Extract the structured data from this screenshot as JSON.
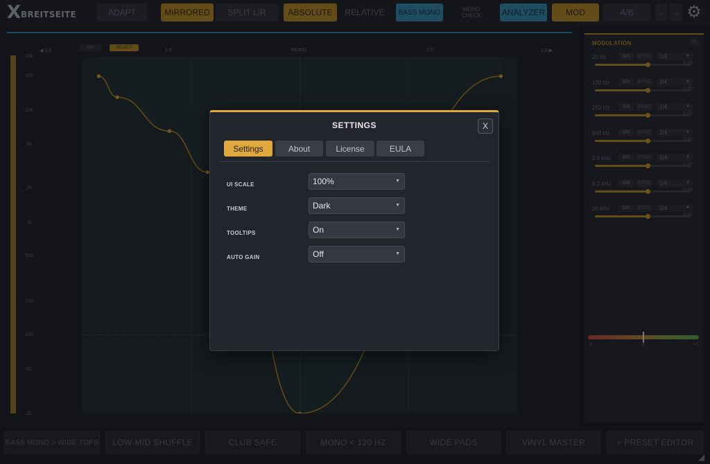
{
  "toolbar": {
    "logo_mark": "X",
    "logo_text": "BREITSEITE",
    "adapt": "ADAPT",
    "mirrored": "MIRRORED",
    "split": "SPLIT L/R",
    "absolute": "ABSOLUTE",
    "relative": "RELATIVE",
    "bass_mono": "BASS MONO",
    "mono_check_1": "MONO",
    "mono_check_2": "CHECK",
    "analyzer": "ANALYZER",
    "mod": "MOD",
    "ab": "A/B",
    "left_arrow": "←",
    "right_arrow": "→",
    "gear": "⚙"
  },
  "visualizer": {
    "chip_1": "INS",
    "chip_2": "SELECT",
    "axis_left": "◀ 2.0",
    "axis_l1": "1.0",
    "axis_mono": "MONO",
    "axis_r1": "1.0",
    "axis_right": "2.0 ▶",
    "y_labels": [
      "20k",
      "20k",
      "10k",
      "5k",
      "2k",
      "1k",
      "500",
      "250",
      "100",
      "50",
      "20"
    ]
  },
  "modulation": {
    "title": "MODULATION",
    "close": "×",
    "rows": [
      {
        "freq": "20 Hz",
        "shape": "SIN",
        "sync": "SYNC",
        "rate": "1/4",
        "value": "0.00",
        "level": 0.55
      },
      {
        "freq": "120 Hz",
        "shape": "SIN",
        "sync": "SYNC",
        "rate": "1/4",
        "value": "0.00",
        "level": 0.55
      },
      {
        "freq": "250 Hz",
        "shape": "SIN",
        "sync": "SYNC",
        "rate": "1/4",
        "value": "0.00",
        "level": 0.55
      },
      {
        "freq": "800 Hz",
        "shape": "SIN",
        "sync": "SYNC",
        "rate": "1/4",
        "value": "0.00",
        "level": 0.55
      },
      {
        "freq": "2.0 kHz",
        "shape": "SIN",
        "sync": "SYNC",
        "rate": "1/4",
        "value": "0.00",
        "level": 0.55
      },
      {
        "freq": "6.0 kHz",
        "shape": "SIN",
        "sync": "SYNC",
        "rate": "1/4",
        "value": "0.00",
        "level": 0.55
      },
      {
        "freq": "20 kHz",
        "shape": "SIN",
        "sync": "SYNC",
        "rate": "1/4",
        "value": "0.00",
        "level": 0.55
      }
    ],
    "balance_left": "-1",
    "balance_center": "0",
    "balance_right": "+1"
  },
  "presets": [
    "BASS MONO > WIDE TOPS",
    "LOW-MID SHUFFLE",
    "CLUB SAFE",
    "MONO < 120 HZ",
    "WIDE PADS",
    "VINYL MASTER",
    "+ PRESET EDITOR"
  ],
  "settings": {
    "title": "SETTINGS",
    "close": "X",
    "tabs": [
      "Settings",
      "About",
      "License",
      "EULA"
    ],
    "rows": [
      {
        "label": "UI SCALE",
        "value": "100%"
      },
      {
        "label": "THEME",
        "value": "Dark"
      },
      {
        "label": "TOOLTIPS",
        "value": "On"
      },
      {
        "label": "AUTO GAIN",
        "value": "Off"
      }
    ]
  },
  "colors": {
    "accent_orange": "#e0a93e",
    "accent_blue": "#2f7fa1",
    "background": "#1b1d23",
    "curve": "#a57e22"
  },
  "curve_points": [
    {
      "w": -1.85,
      "f": 20000
    },
    {
      "w": -1.68,
      "f": 13000
    },
    {
      "w": -1.2,
      "f": 6500
    },
    {
      "w": -0.85,
      "f": 2800
    },
    {
      "w": -0.65,
      "f": 1500
    },
    {
      "w": 0.0,
      "f": 20
    },
    {
      "w": 1.85,
      "f": 20000
    }
  ]
}
